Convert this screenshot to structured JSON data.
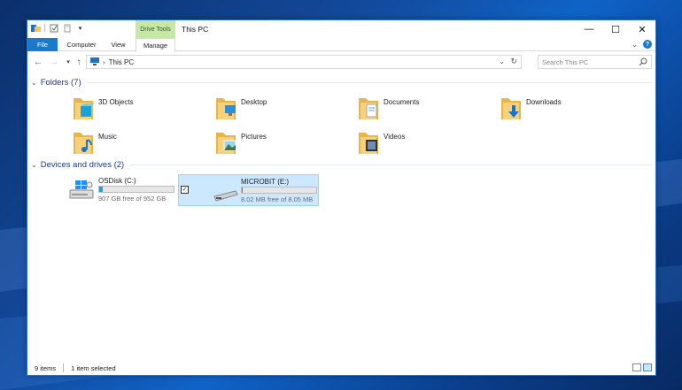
{
  "window": {
    "title": "This PC",
    "context_group": "Drive Tools",
    "controls": [
      "minimize",
      "maximize",
      "close"
    ]
  },
  "ribbon": {
    "tabs": [
      {
        "label": "File"
      },
      {
        "label": "Computer"
      },
      {
        "label": "View"
      },
      {
        "label": "Manage"
      }
    ]
  },
  "nav": {
    "breadcrumb": [
      "This PC"
    ],
    "search_placeholder": "Search This PC"
  },
  "folders_group": {
    "label": "Folders (7)",
    "items": [
      {
        "label": "3D Objects",
        "icon": "3d-objects-folder-icon"
      },
      {
        "label": "Desktop",
        "icon": "desktop-folder-icon"
      },
      {
        "label": "Documents",
        "icon": "documents-folder-icon"
      },
      {
        "label": "Downloads",
        "icon": "downloads-folder-icon"
      },
      {
        "label": "Music",
        "icon": "music-folder-icon"
      },
      {
        "label": "Pictures",
        "icon": "pictures-folder-icon"
      },
      {
        "label": "Videos",
        "icon": "videos-folder-icon"
      }
    ]
  },
  "drives_group": {
    "label": "Devices and drives (2)",
    "items": [
      {
        "name": "OSDisk (C:)",
        "free_text": "907 GB free of 952 GB",
        "used_fraction": 0.05,
        "selected": false
      },
      {
        "name": "MICROBIT (E:)",
        "free_text": "8.02 MB free of 8.05 MB",
        "used_fraction": 0.004,
        "selected": true
      }
    ]
  },
  "status": {
    "item_count": "9 items",
    "selection": "1 item selected"
  },
  "colors": {
    "accent": "#1979ca",
    "drive_tools": "#c6e8a7",
    "selection": "#cce8ff",
    "bar_fill": "#26a0da",
    "folder": "#f4c55a"
  }
}
